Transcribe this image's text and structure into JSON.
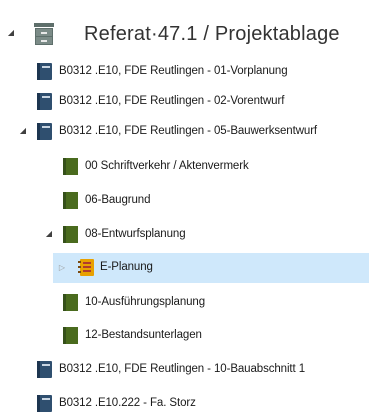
{
  "tree": {
    "root": {
      "label": "Referat·47.1 / Projektablage",
      "icon": "archive-cabinet-icon",
      "expanded": true
    },
    "items": [
      {
        "label": "B0312 .E10, FDE Reutlingen - 01-Vorplanung",
        "icon": "binder-icon",
        "level": 1,
        "expanded": false
      },
      {
        "label": "B0312 .E10, FDE Reutlingen - 02-Vorentwurf",
        "icon": "binder-icon",
        "level": 1,
        "expanded": false
      },
      {
        "label": "B0312 .E10, FDE Reutlingen - 05-Bauwerksentwurf",
        "icon": "binder-icon",
        "level": 1,
        "expanded": true
      },
      {
        "label": "00 Schriftverkehr / Aktenvermerk",
        "icon": "folder-icon",
        "level": 2,
        "expanded": false
      },
      {
        "label": "06-Baugrund",
        "icon": "folder-icon",
        "level": 2,
        "expanded": false
      },
      {
        "label": "08-Entwurfsplanung",
        "icon": "folder-icon",
        "level": 2,
        "expanded": true
      },
      {
        "label": "E-Planung",
        "icon": "register-icon",
        "level": 3,
        "expanded": false,
        "selected": true
      },
      {
        "label": "10-Ausführungsplanung",
        "icon": "folder-icon",
        "level": 2,
        "expanded": false
      },
      {
        "label": "12-Bestandsunterlagen",
        "icon": "folder-icon",
        "level": 2,
        "expanded": false
      },
      {
        "label": "B0312 .E10, FDE Reutlingen - 10-Bauabschnitt 1",
        "icon": "binder-icon",
        "level": 1,
        "expanded": false
      },
      {
        "label": "B0312 .E10.222 - Fa. Storz",
        "icon": "binder-icon",
        "level": 1,
        "expanded": false
      }
    ]
  },
  "colors": {
    "binder": "#2f4f6f",
    "folder": "#4a6b1e",
    "register": "#e8a000",
    "selection": "#cfe8fb",
    "cabinet": "#5e6f6b"
  }
}
